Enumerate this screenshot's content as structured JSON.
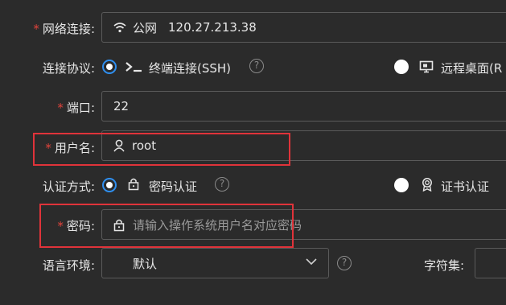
{
  "network": {
    "label": "网络连接",
    "type_text": "公网",
    "ip": "120.27.213.38"
  },
  "protocol": {
    "label": "连接协议",
    "option_ssh": "终端连接(SSH)",
    "option_rdp": "远程桌面(R"
  },
  "port": {
    "label": "端口",
    "value": "22"
  },
  "username": {
    "label": "用户名",
    "value": "root"
  },
  "auth": {
    "label": "认证方式",
    "option_password": "密码认证",
    "option_cert": "证书认证"
  },
  "password": {
    "label": "密码",
    "placeholder": "请输入操作系统用户名对应密码"
  },
  "language": {
    "label": "语言环境",
    "value": "默认"
  },
  "charset": {
    "label": "字符集"
  },
  "colon": ":",
  "required_mark": "*",
  "help_glyph": "?",
  "colors": {
    "accent": "#2f8ff0",
    "required": "#e0433b",
    "highlight": "#e0333a",
    "background": "#2b2b2b"
  }
}
